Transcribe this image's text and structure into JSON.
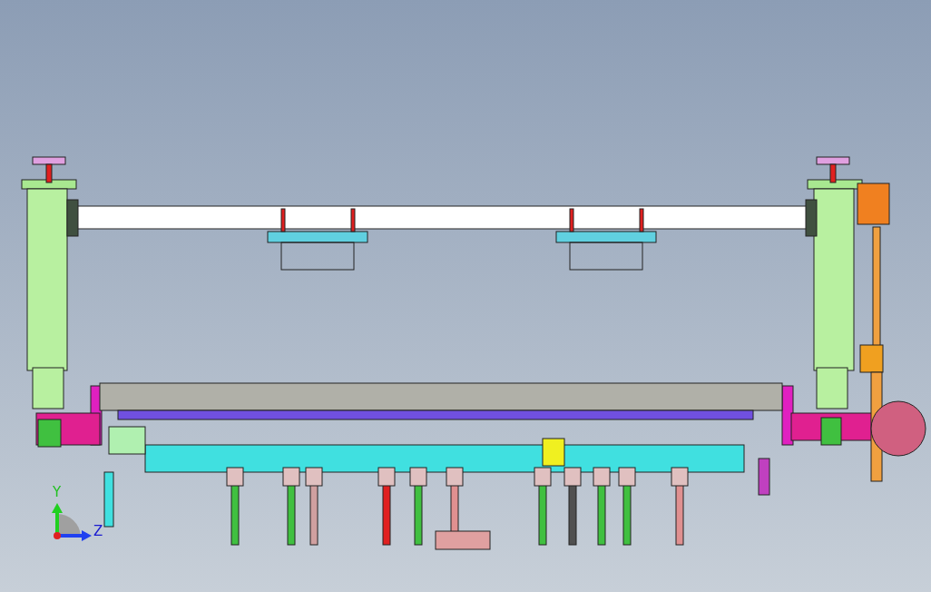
{
  "viewport": {
    "axis_triad": {
      "y_label": "Y",
      "z_label": "Z"
    }
  }
}
